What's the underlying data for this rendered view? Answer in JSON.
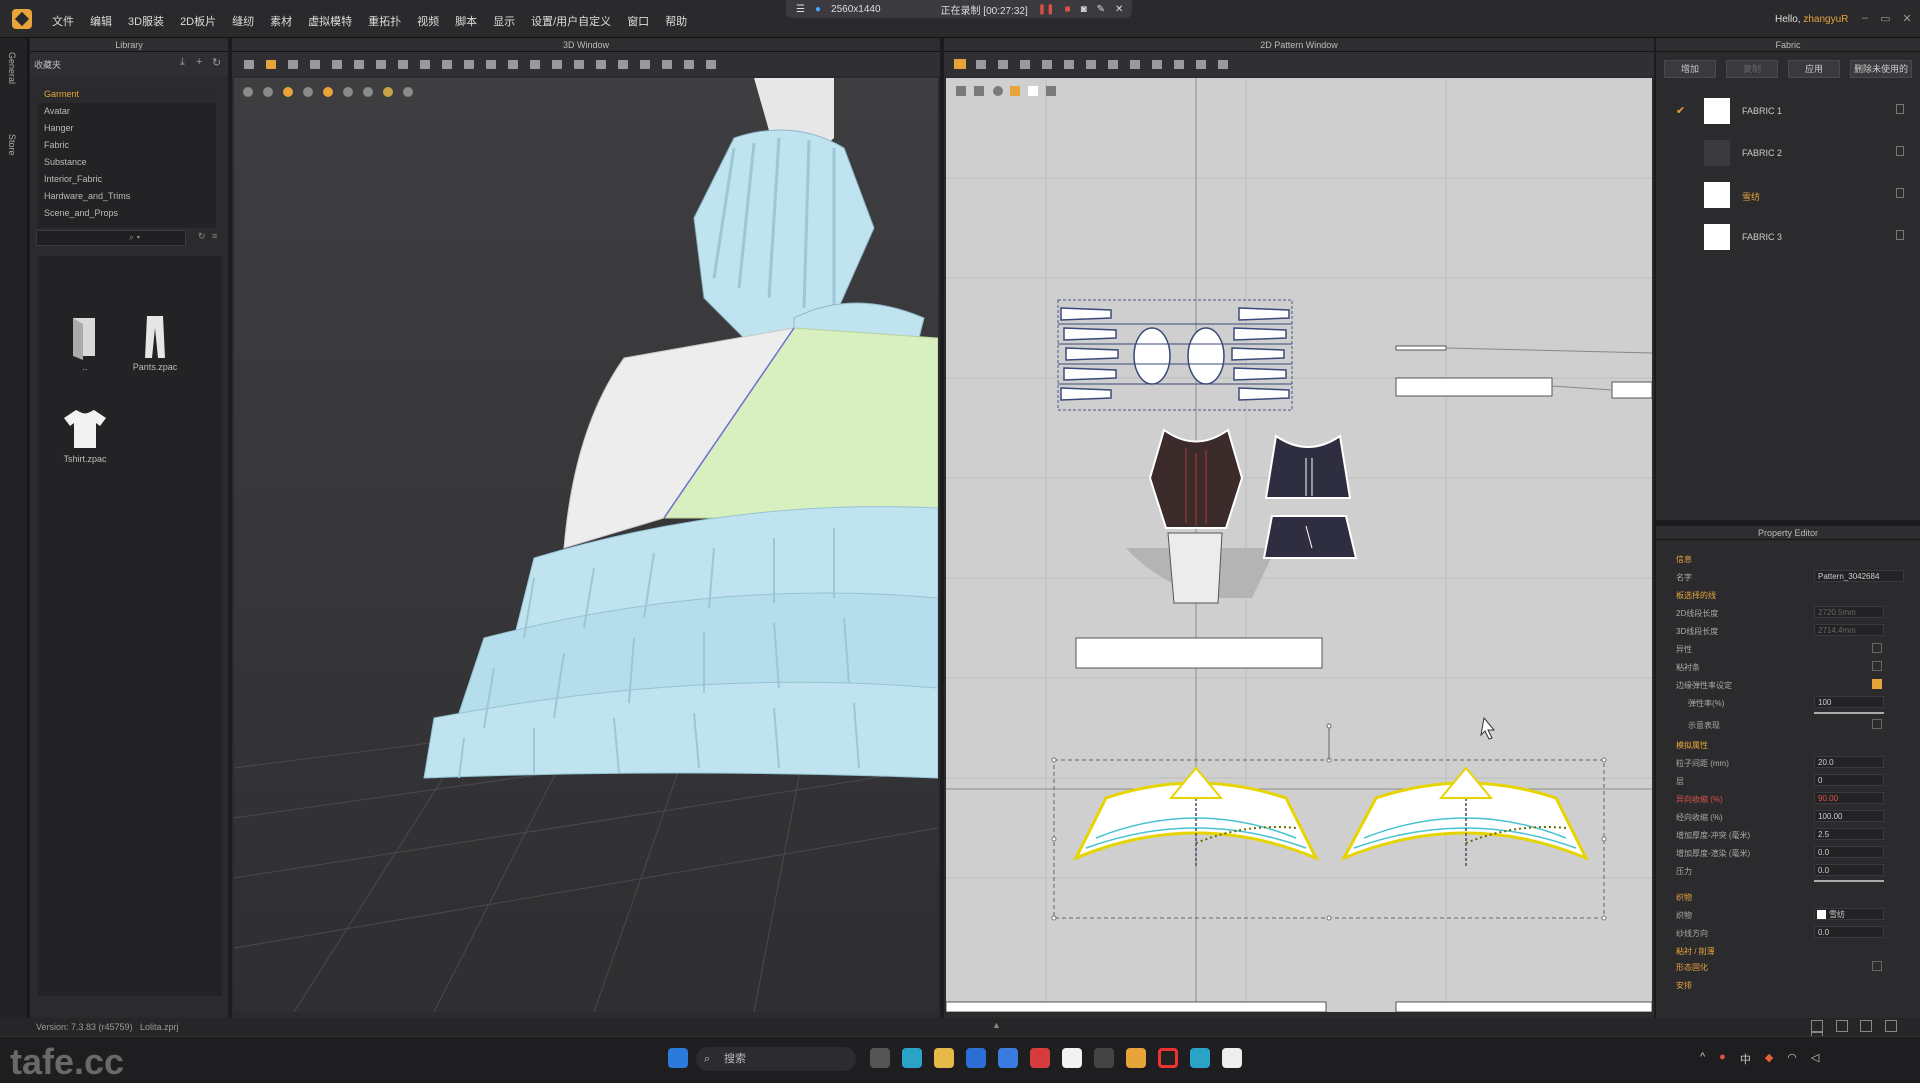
{
  "menubar": {
    "menus": [
      "文件",
      "编辑",
      "3D服装",
      "2D板片",
      "缝纫",
      "素材",
      "虚拟模特",
      "重拓扑",
      "视频",
      "脚本",
      "显示",
      "设置/用户自定义",
      "窗口",
      "帮助"
    ],
    "greeting": "Hello,",
    "username": "zhangyuR"
  },
  "recorder": {
    "resolution": "2560x1440",
    "status": "正在录制 [00:27:32]"
  },
  "left_strip": {
    "tab1": "General",
    "tab2": "Store"
  },
  "library": {
    "title": "Library",
    "favorites_label": "收藏夹",
    "tree": [
      "Garment",
      "Avatar",
      "Hanger",
      "Fabric",
      "Substance",
      "Interior_Fabric",
      "Hardware_and_Trims",
      "Scene_and_Props"
    ],
    "items": [
      {
        "label": "..",
        "icon": "folder-icon"
      },
      {
        "label": "Pants.zpac",
        "icon": "pants-icon"
      },
      {
        "label": "Tshirt.zpac",
        "icon": "tshirt-icon"
      }
    ]
  },
  "window3d": {
    "title": "3D Window"
  },
  "window2d": {
    "title": "2D Pattern Window"
  },
  "fabric_panel": {
    "title": "Fabric",
    "buttons": [
      "增加",
      "复制",
      "应用",
      "删除未使用的"
    ],
    "fabrics": [
      {
        "name": "FABRIC 1",
        "color": "#ffffff",
        "checked": true
      },
      {
        "name": "FABRIC 2",
        "color": "#3a3a3d",
        "checked": false
      },
      {
        "name": "雪纺",
        "color": "#ffffff",
        "checked": false
      },
      {
        "name": "FABRIC 3",
        "color": "#ffffff",
        "checked": false
      }
    ]
  },
  "property_editor": {
    "title": "Property Editor",
    "rows": [
      {
        "label": "信息",
        "section": true
      },
      {
        "label": "名字",
        "value": "Pattern_3042684"
      },
      {
        "label": "板选择的线",
        "section": true
      },
      {
        "label": "2D线段长度",
        "value": "2720.5mm"
      },
      {
        "label": "3D线段长度",
        "value": "2714.4mm"
      },
      {
        "label": "异性",
        "checkbox": false
      },
      {
        "label": "粘衬条",
        "checkbox": false
      },
      {
        "label": "边缘弹性率设定",
        "checkbox": true
      },
      {
        "label": "弹性率(%)",
        "value": "100"
      },
      {
        "label": "示意表现",
        "checkbox": false
      },
      {
        "label": "模拟属性",
        "section": true
      },
      {
        "label": "粒子间距 (mm)",
        "value": "20.0"
      },
      {
        "label": "层",
        "value": "0"
      },
      {
        "label": "异向收缩 (%)",
        "value": "90.00",
        "red": true
      },
      {
        "label": "经向收缩 (%)",
        "value": "100.00"
      },
      {
        "label": "增加厚度-冲突 (毫米)",
        "value": "2.5"
      },
      {
        "label": "增加厚度-渲染 (毫米)",
        "value": "0.0"
      },
      {
        "label": "压力",
        "value": "0.0"
      },
      {
        "label": "织物",
        "section": true
      },
      {
        "label": "织物",
        "value": "雪纺"
      },
      {
        "label": "纱线方向",
        "value": "0.0"
      },
      {
        "label": "粘衬 / 削薄",
        "section": true
      },
      {
        "label": "形态固化",
        "checkbox": false
      },
      {
        "label": "安排",
        "section": true
      }
    ]
  },
  "statusbar": {
    "version": "Version:   7.3.83 (r45759)",
    "file": "Lolita.zprj"
  },
  "taskbar": {
    "watermark": "tafe.cc",
    "search_placeholder": "搜索",
    "ime": "中"
  },
  "colors": {
    "accent": "#e8a33a",
    "garment_blue": "#bfe3ef",
    "garment_green": "#d8efc0",
    "pattern_bg": "#cfcfcf"
  }
}
